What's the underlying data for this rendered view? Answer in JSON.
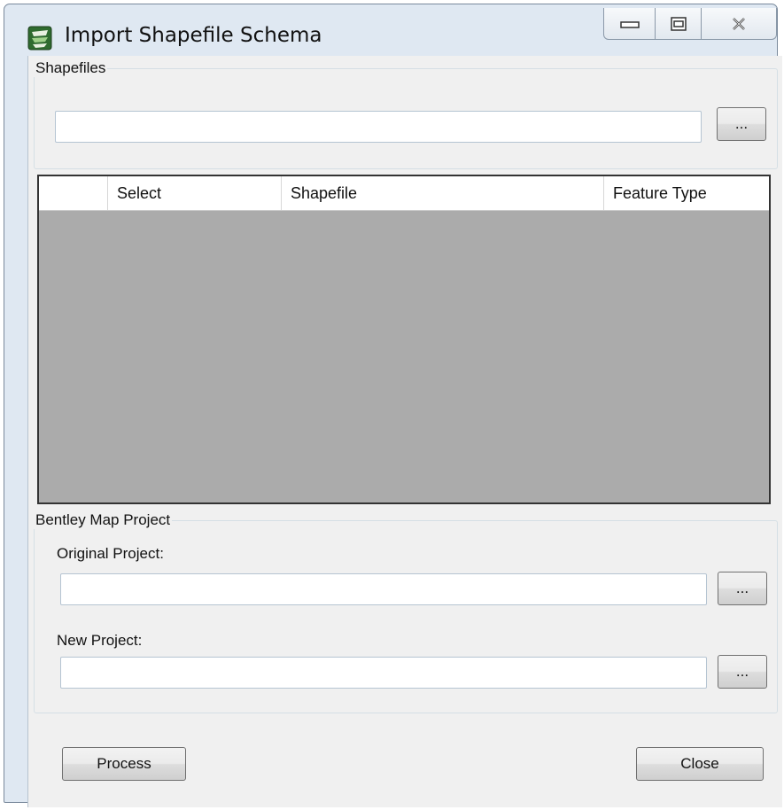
{
  "window": {
    "title": "Import Shapefile Schema",
    "icon": "shapefile-app-icon",
    "controls": [
      "minimize-icon",
      "restore-icon",
      "close-icon"
    ]
  },
  "shapefiles": {
    "group_label": "Shapefiles",
    "path_value": "",
    "browse_label": "...",
    "columns": [
      "",
      "Select",
      "Shapefile",
      "Feature Type"
    ]
  },
  "project": {
    "group_label": "Bentley Map Project",
    "original_label": "Original Project:",
    "original_value": "",
    "original_browse_label": "...",
    "new_label": "New Project:",
    "new_value": "",
    "new_browse_label": "..."
  },
  "footer": {
    "process_label": "Process",
    "close_label": "Close"
  },
  "colors": {
    "grid_background": "#ababab",
    "window_frame": "#dfe8f2",
    "client": "#f0f0f0"
  }
}
